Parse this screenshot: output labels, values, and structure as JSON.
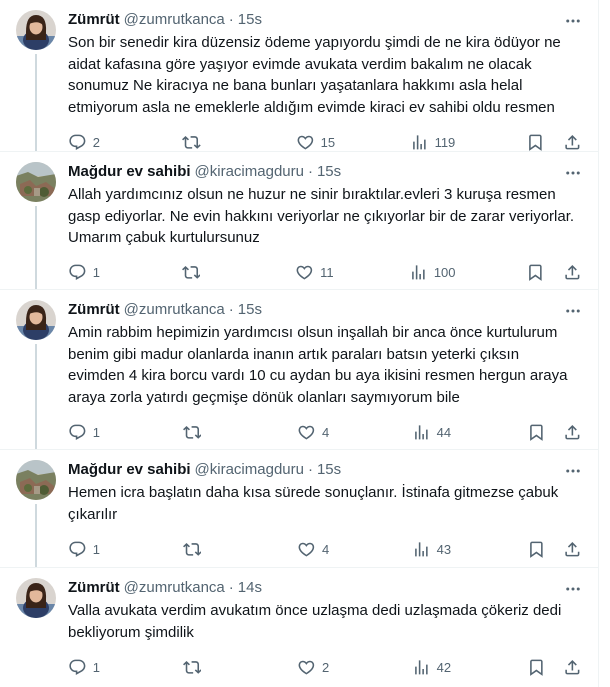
{
  "tweets": [
    {
      "display_name": "Zümrüt",
      "handle": "@zumrutkanca",
      "separator": "·",
      "time": "15s",
      "text": "Son bir senedir kira düzensiz ödeme yapıyordu şimdi de ne kira ödüyor ne aidat kafasına göre yaşıyor evimde avukata verdim bakalım ne olacak sonumuz Ne kiracıya ne bana bunları yaşatanlara hakkımı asla helal etmiyorum asla ne emeklerle aldığım evimde kiraci ev sahibi oldu resmen",
      "replies": "2",
      "retweets": "",
      "likes": "15",
      "views": "119",
      "avatar": "woman-portrait"
    },
    {
      "display_name": "Mağdur ev sahibi",
      "handle": "@kiracimagduru",
      "separator": "·",
      "time": "15s",
      "text": "Allah yardımcınız olsun ne huzur ne sinir bıraktılar.evleri 3 kuruşa resmen gasp ediyorlar. Ne evin hakkını veriyorlar ne çıkıyorlar bir de zarar veriyorlar. Umarım çabuk kurtulursunuz",
      "replies": "1",
      "retweets": "",
      "likes": "11",
      "views": "100",
      "avatar": "ruin-landscape"
    },
    {
      "display_name": "Zümrüt",
      "handle": "@zumrutkanca",
      "separator": "·",
      "time": "15s",
      "text": "Amin rabbim hepimizin yardımcısı olsun inşallah bir anca önce kurtulurum benim gibi madur olanlarda inanın artık paraları batsın yeterki çıksın evimden 4 kira borcu vardı 10 cu aydan bu aya ikisini resmen hergun araya araya zorla yatırdı geçmişe dönük olanları saymıyorum bile",
      "replies": "1",
      "retweets": "",
      "likes": "4",
      "views": "44",
      "avatar": "woman-portrait"
    },
    {
      "display_name": "Mağdur ev sahibi",
      "handle": "@kiracimagduru",
      "separator": "·",
      "time": "15s",
      "text": "Hemen icra başlatın daha kısa sürede sonuçlanır. İstinafa gitmezse çabuk çıkarılır",
      "replies": "1",
      "retweets": "",
      "likes": "4",
      "views": "43",
      "avatar": "ruin-landscape"
    },
    {
      "display_name": "Zümrüt",
      "handle": "@zumrutkanca",
      "separator": "·",
      "time": "14s",
      "text": "Valla avukata verdim avukatım önce uzlaşma dedi uzlaşmada çökeriz dedi bekliyorum şimdilik",
      "replies": "1",
      "retweets": "",
      "likes": "2",
      "views": "42",
      "avatar": "woman-portrait"
    }
  ],
  "icons": {
    "reply": "reply-icon",
    "retweet": "retweet-icon",
    "like": "heart-icon",
    "views": "views-chart-icon",
    "bookmark": "bookmark-icon",
    "share": "share-icon",
    "more": "more-dots-icon"
  },
  "colors": {
    "text": "#0f1419",
    "secondary": "#536471",
    "border": "#eff3f4",
    "thread_line": "#cfd9de"
  }
}
